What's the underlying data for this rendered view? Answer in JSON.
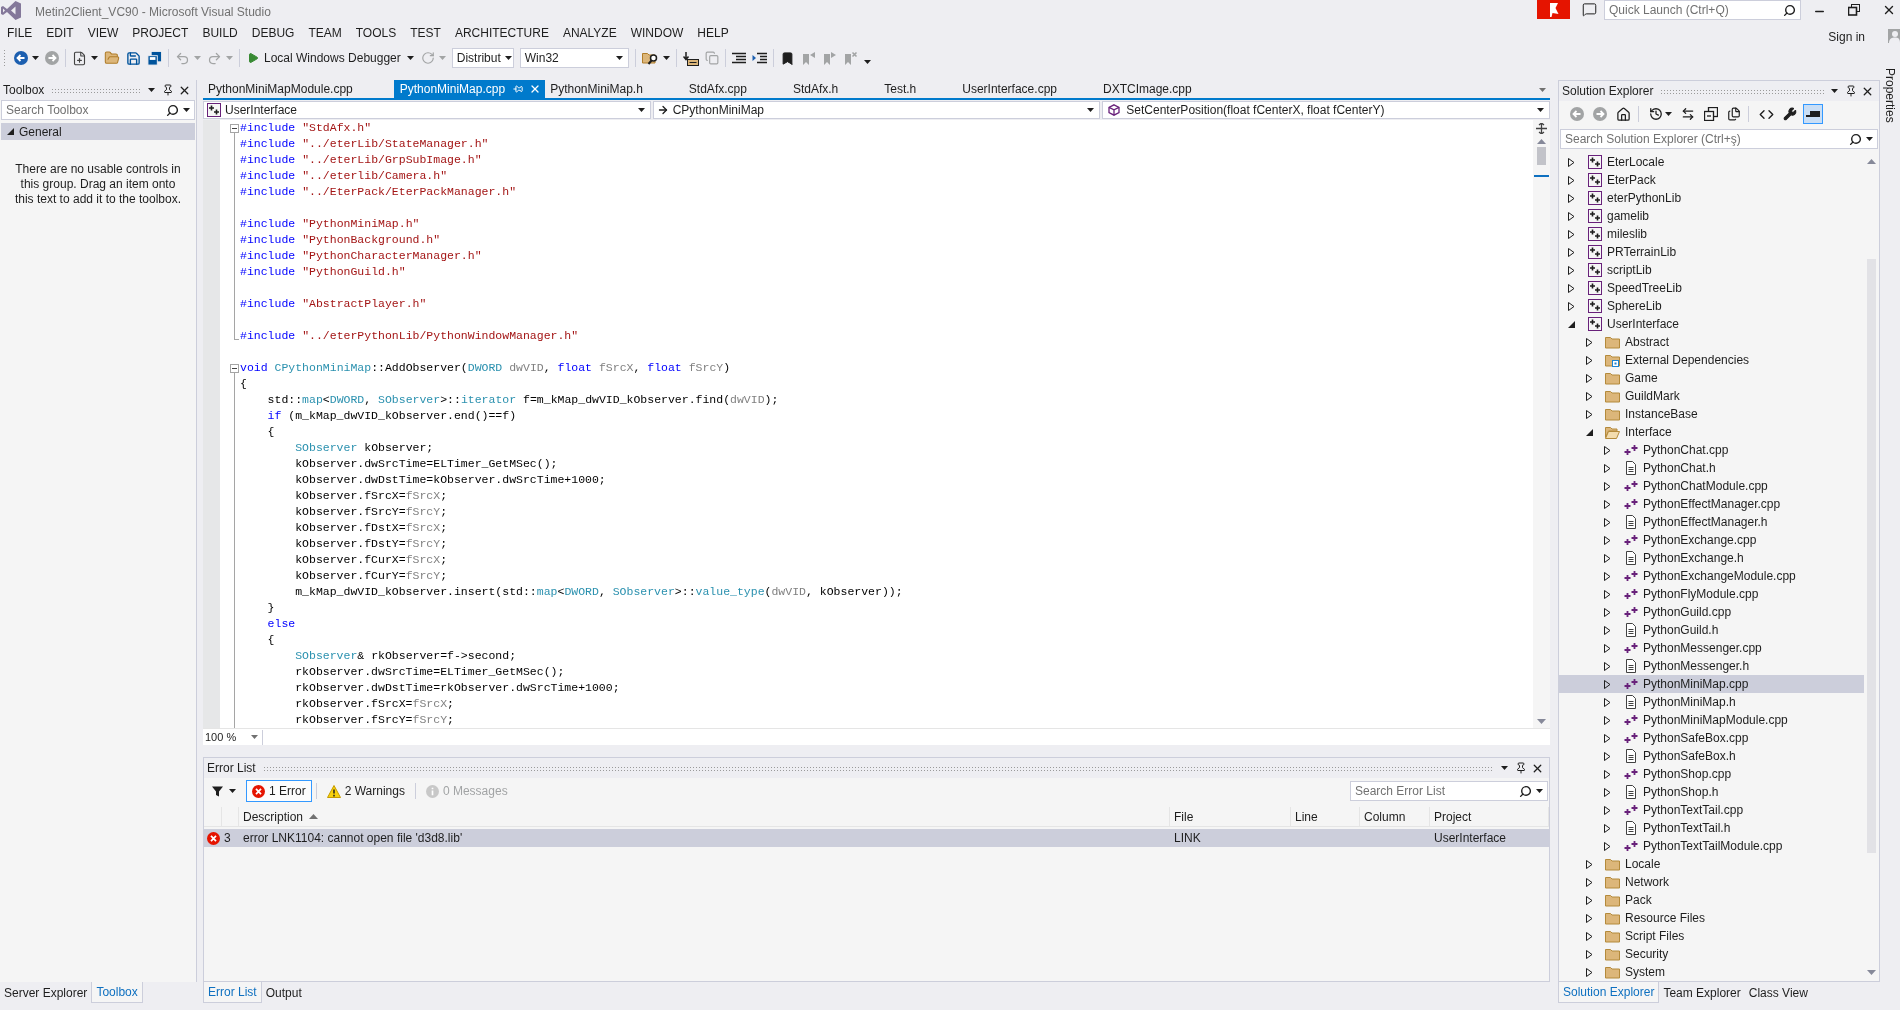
{
  "window": {
    "title": "Metin2Client_VC90 - Microsoft Visual Studio"
  },
  "title_bar": {
    "quick_launch": {
      "placeholder": "Quick Launch (Ctrl+Q)"
    }
  },
  "menu": {
    "items": [
      "FILE",
      "EDIT",
      "VIEW",
      "PROJECT",
      "BUILD",
      "DEBUG",
      "TEAM",
      "TOOLS",
      "TEST",
      "ARCHITECTURE",
      "ANALYZE",
      "WINDOW",
      "HELP"
    ],
    "sign_in": "Sign in"
  },
  "toolbar": {
    "groups": [
      [
        {
          "kind": "back",
          "disabled": false,
          "dropdown": true
        },
        {
          "kind": "forward",
          "disabled": true,
          "dropdown": false
        }
      ],
      [
        {
          "kind": "new-project",
          "disabled": false,
          "dropdown": true
        },
        {
          "kind": "open",
          "disabled": false,
          "dropdown": false
        },
        {
          "kind": "save",
          "disabled": false,
          "dropdown": false
        },
        {
          "kind": "save-all",
          "disabled": false,
          "dropdown": false
        }
      ],
      [
        {
          "kind": "undo",
          "disabled": true,
          "dropdown": true
        },
        {
          "kind": "redo",
          "disabled": true,
          "dropdown": true
        }
      ],
      [
        {
          "kind": "run",
          "label": "Local Windows Debugger",
          "disabled": false,
          "dropdown": true
        },
        {
          "kind": "restart",
          "disabled": true,
          "dropdown": true
        },
        {
          "kind": "combo",
          "label": "Distribut",
          "disabled": false,
          "dropdown": true
        },
        {
          "kind": "combo",
          "label": "Win32",
          "disabled": false,
          "dropdown": true
        }
      ],
      [
        {
          "kind": "find",
          "disabled": false,
          "dropdown": true
        }
      ],
      [
        {
          "kind": "tray",
          "disabled": false,
          "dropdown": false
        },
        {
          "kind": "pages",
          "disabled": true,
          "dropdown": false
        }
      ],
      [
        {
          "kind": "lines",
          "disabled": false,
          "dropdown": false
        },
        {
          "kind": "lines-arrow",
          "disabled": false,
          "dropdown": false
        }
      ],
      [
        {
          "kind": "bookmark",
          "disabled": false,
          "dropdown": false
        },
        {
          "kind": "bookmark-prev",
          "disabled": true,
          "dropdown": false
        },
        {
          "kind": "bookmark-next",
          "disabled": true,
          "dropdown": false
        },
        {
          "kind": "bookmark-clear",
          "disabled": true,
          "dropdown": false
        }
      ]
    ]
  },
  "toolbox": {
    "title": "Toolbox",
    "search": {
      "placeholder": "Search Toolbox"
    },
    "group": {
      "label": "General",
      "expanded": true
    },
    "message": "There are no usable controls in this group. Drag an item onto this text to add it to the toolbox.",
    "tabs": [
      {
        "label": "Server Explorer",
        "selected": false
      },
      {
        "label": "Toolbox",
        "selected": true
      }
    ]
  },
  "editor": {
    "tabs": [
      {
        "label": "PythonMiniMapModule.cpp",
        "selected": false
      },
      {
        "label": "PythonMiniMap.cpp",
        "selected": true
      },
      {
        "label": "PythonMiniMap.h",
        "selected": false
      },
      {
        "label": "StdAfx.cpp",
        "selected": false
      },
      {
        "label": "StdAfx.h",
        "selected": false
      },
      {
        "label": "Test.h",
        "selected": false
      },
      {
        "label": "UserInterface.cpp",
        "selected": false
      },
      {
        "label": "DXTCImage.cpp",
        "selected": false
      }
    ],
    "nav": {
      "project": "UserInterface",
      "scope": "CPythonMiniMap",
      "member": "SetCenterPosition(float fCenterX, float fCenterY)"
    },
    "blocks": [
      {
        "foldable": true,
        "groups": [
          [
            {
              "tokens": [
                {
                  "kind": "keyword",
                  "text": "#include "
                },
                {
                  "kind": "string",
                  "text": "\"StdAfx.h\""
                }
              ]
            },
            {
              "tokens": [
                {
                  "kind": "keyword",
                  "text": "#include "
                },
                {
                  "kind": "string",
                  "text": "\"../eterLib/StateManager.h\""
                }
              ]
            },
            {
              "tokens": [
                {
                  "kind": "keyword",
                  "text": "#include "
                },
                {
                  "kind": "string",
                  "text": "\"../eterLib/GrpSubImage.h\""
                }
              ]
            },
            {
              "tokens": [
                {
                  "kind": "keyword",
                  "text": "#include "
                },
                {
                  "kind": "string",
                  "text": "\"../eterlib/Camera.h\""
                }
              ]
            },
            {
              "tokens": [
                {
                  "kind": "keyword",
                  "text": "#include "
                },
                {
                  "kind": "string",
                  "text": "\"../EterPack/EterPackManager.h\""
                }
              ]
            }
          ],
          [
            {
              "tokens": [
                {
                  "kind": "keyword",
                  "text": "#include "
                },
                {
                  "kind": "string",
                  "text": "\"PythonMiniMap.h\""
                }
              ]
            },
            {
              "tokens": [
                {
                  "kind": "keyword",
                  "text": "#include "
                },
                {
                  "kind": "string",
                  "text": "\"PythonBackground.h\""
                }
              ]
            },
            {
              "tokens": [
                {
                  "kind": "keyword",
                  "text": "#include "
                },
                {
                  "kind": "string",
                  "text": "\"PythonCharacterManager.h\""
                }
              ]
            },
            {
              "tokens": [
                {
                  "kind": "keyword",
                  "text": "#include "
                },
                {
                  "kind": "string",
                  "text": "\"PythonGuild.h\""
                }
              ]
            }
          ],
          [
            {
              "tokens": [
                {
                  "kind": "keyword",
                  "text": "#include "
                },
                {
                  "kind": "string",
                  "text": "\"AbstractPlayer.h\""
                }
              ]
            }
          ],
          [
            {
              "tokens": [
                {
                  "kind": "keyword",
                  "text": "#include "
                },
                {
                  "kind": "string",
                  "text": "\"../eterPythonLib/PythonWindowManager.h\""
                }
              ]
            }
          ]
        ]
      },
      {
        "foldable": true,
        "groups": [
          [
            {
              "tokens": [
                {
                  "kind": "keyword",
                  "text": "void "
                },
                {
                  "kind": "type",
                  "text": "CPythonMiniMap"
                },
                {
                  "kind": "text",
                  "text": "::AddObserver("
                },
                {
                  "kind": "type",
                  "text": "DWORD "
                },
                {
                  "kind": "param",
                  "text": "dwVID"
                },
                {
                  "kind": "text",
                  "text": ", "
                },
                {
                  "kind": "keyword",
                  "text": "float "
                },
                {
                  "kind": "param",
                  "text": "fSrcX"
                },
                {
                  "kind": "text",
                  "text": ", "
                },
                {
                  "kind": "keyword",
                  "text": "float "
                },
                {
                  "kind": "param",
                  "text": "fSrcY"
                },
                {
                  "kind": "text",
                  "text": ")"
                }
              ]
            },
            {
              "tokens": [
                {
                  "kind": "text",
                  "text": "{"
                }
              ]
            },
            {
              "tokens": [
                {
                  "kind": "text",
                  "text": "    std::"
                },
                {
                  "kind": "type",
                  "text": "map"
                },
                {
                  "kind": "text",
                  "text": "<"
                },
                {
                  "kind": "type",
                  "text": "DWORD"
                },
                {
                  "kind": "text",
                  "text": ", "
                },
                {
                  "kind": "type",
                  "text": "SObserver"
                },
                {
                  "kind": "text",
                  "text": ">::"
                },
                {
                  "kind": "type",
                  "text": "iterator"
                },
                {
                  "kind": "text",
                  "text": " f=m_kMap_dwVID_kObserver.find("
                },
                {
                  "kind": "param",
                  "text": "dwVID"
                },
                {
                  "kind": "text",
                  "text": ");"
                }
              ]
            },
            {
              "tokens": [
                {
                  "kind": "keyword",
                  "text": "    if"
                },
                {
                  "kind": "text",
                  "text": " (m_kMap_dwVID_kObserver.end()==f)"
                }
              ]
            },
            {
              "tokens": [
                {
                  "kind": "text",
                  "text": "    {"
                }
              ]
            },
            {
              "tokens": [
                {
                  "kind": "type",
                  "text": "        SObserver"
                },
                {
                  "kind": "text",
                  "text": " kObserver;"
                }
              ]
            },
            {
              "tokens": [
                {
                  "kind": "text",
                  "text": "        kObserver.dwSrcTime=ELTimer_GetMSec();"
                }
              ]
            },
            {
              "tokens": [
                {
                  "kind": "text",
                  "text": "        kObserver.dwDstTime=kObserver.dwSrcTime+1000;"
                }
              ]
            },
            {
              "tokens": [
                {
                  "kind": "text",
                  "text": "        kObserver.fSrcX="
                },
                {
                  "kind": "param",
                  "text": "fSrcX"
                },
                {
                  "kind": "text",
                  "text": ";"
                }
              ]
            },
            {
              "tokens": [
                {
                  "kind": "text",
                  "text": "        kObserver.fSrcY="
                },
                {
                  "kind": "param",
                  "text": "fSrcY"
                },
                {
                  "kind": "text",
                  "text": ";"
                }
              ]
            },
            {
              "tokens": [
                {
                  "kind": "text",
                  "text": "        kObserver.fDstX="
                },
                {
                  "kind": "param",
                  "text": "fSrcX"
                },
                {
                  "kind": "text",
                  "text": ";"
                }
              ]
            },
            {
              "tokens": [
                {
                  "kind": "text",
                  "text": "        kObserver.fDstY="
                },
                {
                  "kind": "param",
                  "text": "fSrcY"
                },
                {
                  "kind": "text",
                  "text": ";"
                }
              ]
            },
            {
              "tokens": [
                {
                  "kind": "text",
                  "text": "        kObserver.fCurX="
                },
                {
                  "kind": "param",
                  "text": "fSrcX"
                },
                {
                  "kind": "text",
                  "text": ";"
                }
              ]
            },
            {
              "tokens": [
                {
                  "kind": "text",
                  "text": "        kObserver.fCurY="
                },
                {
                  "kind": "param",
                  "text": "fSrcY"
                },
                {
                  "kind": "text",
                  "text": ";"
                }
              ]
            },
            {
              "tokens": [
                {
                  "kind": "text",
                  "text": "        m_kMap_dwVID_kObserver.insert(std::"
                },
                {
                  "kind": "type",
                  "text": "map"
                },
                {
                  "kind": "text",
                  "text": "<"
                },
                {
                  "kind": "type",
                  "text": "DWORD"
                },
                {
                  "kind": "text",
                  "text": ", "
                },
                {
                  "kind": "type",
                  "text": "SObserver"
                },
                {
                  "kind": "text",
                  "text": ">::"
                },
                {
                  "kind": "type",
                  "text": "value_type"
                },
                {
                  "kind": "text",
                  "text": "("
                },
                {
                  "kind": "param",
                  "text": "dwVID"
                },
                {
                  "kind": "text",
                  "text": ", kObserver));"
                }
              ]
            },
            {
              "tokens": [
                {
                  "kind": "text",
                  "text": "    }"
                }
              ]
            },
            {
              "tokens": [
                {
                  "kind": "keyword",
                  "text": "    else"
                }
              ]
            },
            {
              "tokens": [
                {
                  "kind": "text",
                  "text": "    {"
                }
              ]
            },
            {
              "tokens": [
                {
                  "kind": "type",
                  "text": "        SObserver"
                },
                {
                  "kind": "text",
                  "text": "& rkObserver=f->second;"
                }
              ]
            },
            {
              "tokens": [
                {
                  "kind": "text",
                  "text": "        rkObserver.dwSrcTime=ELTimer_GetMSec();"
                }
              ]
            },
            {
              "tokens": [
                {
                  "kind": "text",
                  "text": "        rkObserver.dwDstTime=rkObserver.dwSrcTime+1000;"
                }
              ]
            },
            {
              "tokens": [
                {
                  "kind": "text",
                  "text": "        rkObserver.fSrcX="
                },
                {
                  "kind": "param",
                  "text": "fSrcX"
                },
                {
                  "kind": "text",
                  "text": ";"
                }
              ]
            },
            {
              "tokens": [
                {
                  "kind": "text",
                  "text": "        rkObserver.fSrcY="
                },
                {
                  "kind": "param",
                  "text": "fSrcY"
                },
                {
                  "kind": "text",
                  "text": ";"
                }
              ]
            }
          ]
        ]
      }
    ],
    "zoom": "100 %"
  },
  "error_list": {
    "title": "Error List",
    "filters": [
      {
        "kind": "error",
        "label": "1 Error",
        "selected": true,
        "disabled": false
      },
      {
        "kind": "warning",
        "label": "2 Warnings",
        "selected": false,
        "disabled": false
      },
      {
        "kind": "message",
        "label": "0 Messages",
        "selected": false,
        "disabled": true
      }
    ],
    "search": {
      "placeholder": "Search Error List"
    },
    "columns": [
      {
        "label": "Description",
        "sorted": true
      },
      {
        "label": "File",
        "sorted": false
      },
      {
        "label": "Line",
        "sorted": false
      },
      {
        "label": "Column",
        "sorted": false
      },
      {
        "label": "Project",
        "sorted": false
      }
    ],
    "rows": [
      {
        "kind": "error",
        "number": "3",
        "description": "error LNK1104: cannot open file 'd3d8.lib'",
        "file": "LINK",
        "project": "UserInterface",
        "selected": true
      }
    ],
    "tabs": [
      {
        "label": "Error List",
        "selected": true
      },
      {
        "label": "Output",
        "selected": false
      }
    ]
  },
  "solution_explorer": {
    "title": "Solution Explorer",
    "toolbar": [
      [
        {
          "kind": "back",
          "disabled": true,
          "pressed": false
        },
        {
          "kind": "forward",
          "disabled": true,
          "pressed": false
        },
        {
          "kind": "home",
          "disabled": false,
          "pressed": false
        }
      ],
      [
        {
          "kind": "history",
          "disabled": false,
          "pressed": false
        },
        {
          "kind": "sync",
          "disabled": false,
          "pressed": false
        },
        {
          "kind": "collapse",
          "disabled": false,
          "pressed": false
        },
        {
          "kind": "show-all",
          "disabled": false,
          "pressed": false
        }
      ],
      [
        {
          "kind": "code",
          "disabled": false,
          "pressed": false
        },
        {
          "kind": "properties",
          "disabled": false,
          "pressed": false
        },
        {
          "kind": "preview",
          "disabled": false,
          "pressed": true
        }
      ]
    ],
    "search": {
      "placeholder": "Search Solution Explorer (Ctrl+ş)"
    },
    "tree": [
      {
        "label": "EterLocale",
        "kind": "project",
        "expanded": false,
        "selected": false
      },
      {
        "label": "EterPack",
        "kind": "project",
        "expanded": false,
        "selected": false
      },
      {
        "label": "eterPythonLib",
        "kind": "project",
        "expanded": false,
        "selected": false
      },
      {
        "label": "gamelib",
        "kind": "project",
        "expanded": false,
        "selected": false
      },
      {
        "label": "mileslib",
        "kind": "project",
        "expanded": false,
        "selected": false
      },
      {
        "label": "PRTerrainLib",
        "kind": "project",
        "expanded": false,
        "selected": false
      },
      {
        "label": "scriptLib",
        "kind": "project",
        "expanded": false,
        "selected": false
      },
      {
        "label": "SpeedTreeLib",
        "kind": "project",
        "expanded": false,
        "selected": false
      },
      {
        "label": "SphereLib",
        "kind": "project",
        "expanded": false,
        "selected": false
      },
      {
        "label": "UserInterface",
        "kind": "project",
        "expanded": true,
        "selected": false,
        "children": [
          {
            "label": "Abstract",
            "kind": "folder",
            "expanded": false,
            "selected": false
          },
          {
            "label": "External Dependencies",
            "kind": "external",
            "expanded": false,
            "selected": false
          },
          {
            "label": "Game",
            "kind": "folder",
            "expanded": false,
            "selected": false
          },
          {
            "label": "GuildMark",
            "kind": "folder",
            "expanded": false,
            "selected": false
          },
          {
            "label": "InstanceBase",
            "kind": "folder",
            "expanded": false,
            "selected": false
          },
          {
            "label": "Interface",
            "kind": "folder",
            "expanded": true,
            "selected": false,
            "children": [
              {
                "label": "PythonChat.cpp",
                "kind": "cpp",
                "expanded": false,
                "selected": false
              },
              {
                "label": "PythonChat.h",
                "kind": "h",
                "expanded": false,
                "selected": false
              },
              {
                "label": "PythonChatModule.cpp",
                "kind": "cpp",
                "expanded": false,
                "selected": false
              },
              {
                "label": "PythonEffectManager.cpp",
                "kind": "cpp",
                "expanded": false,
                "selected": false
              },
              {
                "label": "PythonEffectManager.h",
                "kind": "h",
                "expanded": false,
                "selected": false
              },
              {
                "label": "PythonExchange.cpp",
                "kind": "cpp",
                "expanded": false,
                "selected": false
              },
              {
                "label": "PythonExchange.h",
                "kind": "h",
                "expanded": false,
                "selected": false
              },
              {
                "label": "PythonExchangeModule.cpp",
                "kind": "cpp",
                "expanded": false,
                "selected": false
              },
              {
                "label": "PythonFlyModule.cpp",
                "kind": "cpp",
                "expanded": false,
                "selected": false
              },
              {
                "label": "PythonGuild.cpp",
                "kind": "cpp",
                "expanded": false,
                "selected": false
              },
              {
                "label": "PythonGuild.h",
                "kind": "h",
                "expanded": false,
                "selected": false
              },
              {
                "label": "PythonMessenger.cpp",
                "kind": "cpp",
                "expanded": false,
                "selected": false
              },
              {
                "label": "PythonMessenger.h",
                "kind": "h",
                "expanded": false,
                "selected": false
              },
              {
                "label": "PythonMiniMap.cpp",
                "kind": "cpp",
                "expanded": false,
                "selected": true
              },
              {
                "label": "PythonMiniMap.h",
                "kind": "h",
                "expanded": false,
                "selected": false
              },
              {
                "label": "PythonMiniMapModule.cpp",
                "kind": "cpp",
                "expanded": false,
                "selected": false
              },
              {
                "label": "PythonSafeBox.cpp",
                "kind": "cpp",
                "expanded": false,
                "selected": false
              },
              {
                "label": "PythonSafeBox.h",
                "kind": "h",
                "expanded": false,
                "selected": false
              },
              {
                "label": "PythonShop.cpp",
                "kind": "cpp",
                "expanded": false,
                "selected": false
              },
              {
                "label": "PythonShop.h",
                "kind": "h",
                "expanded": false,
                "selected": false
              },
              {
                "label": "PythonTextTail.cpp",
                "kind": "cpp",
                "expanded": false,
                "selected": false
              },
              {
                "label": "PythonTextTail.h",
                "kind": "h",
                "expanded": false,
                "selected": false
              },
              {
                "label": "PythonTextTailModule.cpp",
                "kind": "cpp",
                "expanded": false,
                "selected": false
              }
            ]
          },
          {
            "label": "Locale",
            "kind": "folder",
            "expanded": false,
            "selected": false
          },
          {
            "label": "Network",
            "kind": "folder",
            "expanded": false,
            "selected": false
          },
          {
            "label": "Pack",
            "kind": "folder",
            "expanded": false,
            "selected": false
          },
          {
            "label": "Resource Files",
            "kind": "folder",
            "expanded": false,
            "selected": false
          },
          {
            "label": "Script Files",
            "kind": "folder",
            "expanded": false,
            "selected": false
          },
          {
            "label": "Security",
            "kind": "folder",
            "expanded": false,
            "selected": false
          },
          {
            "label": "System",
            "kind": "folder",
            "expanded": false,
            "selected": false
          }
        ]
      }
    ],
    "tabs": [
      {
        "label": "Solution Explorer",
        "selected": true
      },
      {
        "label": "Team Explorer",
        "selected": false
      },
      {
        "label": "Class View",
        "selected": false
      }
    ]
  },
  "properties_tab": {
    "label": "Properties"
  }
}
